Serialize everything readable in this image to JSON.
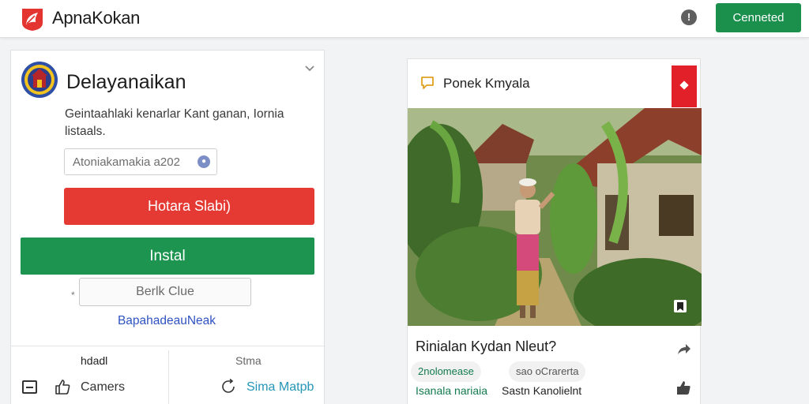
{
  "header": {
    "app_title": "ApnaKokan",
    "connect_label": "Cenneted",
    "info_glyph": "!",
    "logo_icon": "leaf-logo-icon",
    "brand_color": "#e53a34",
    "accent_color": "#1b8f4c"
  },
  "left_card": {
    "title": "Delayanaikan",
    "description": "Geintaahlaki kenarlar Kant ganan, Iornia listaals.",
    "search_placeholder": "Atoniakamakia a202",
    "primary_button": "Hotara Slabi)",
    "install_button": "Instal",
    "secondary_button": "Berlk Clue",
    "side_marker": "*",
    "link_text": "BapahadeauNeak",
    "columns": {
      "left_header": "hdadl",
      "right_header": "Stma"
    },
    "footer": {
      "camera_label": "Camers",
      "right_link": "Sima Matpb"
    }
  },
  "right_card": {
    "title": "Ponek Kmyala",
    "post_title": "Rinialan Kydan Nleut?",
    "tags": [
      "2nolomease",
      "sao oCrarerta"
    ],
    "meta": [
      "Isanala nariaia",
      "Sastn Kanolielnt"
    ]
  }
}
